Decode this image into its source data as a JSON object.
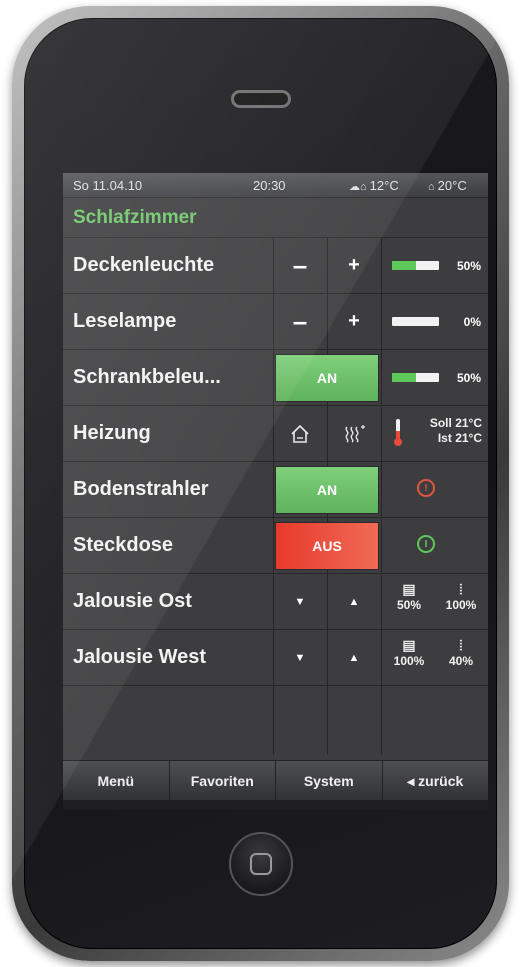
{
  "status_bar": {
    "date": "So 11.04.10",
    "time": "20:30",
    "outdoor_icon": "outdoor-temp-icon",
    "outdoor_temp": "12°C",
    "indoor_icon": "house-temp-icon",
    "indoor_temp": "20°C"
  },
  "room": {
    "title": "Schlafzimmer"
  },
  "devices": [
    {
      "label": "Deckenleuchte",
      "type": "dimmer",
      "minus": "–",
      "plus": "+",
      "level": 0.5,
      "value": "50%"
    },
    {
      "label": "Leselampe",
      "type": "dimmer",
      "minus": "–",
      "plus": "+",
      "level": 0.0,
      "value": "0%"
    },
    {
      "label": "Schrankbeleu...",
      "type": "switch-dimmer",
      "state": "AN",
      "level": 0.5,
      "value": "50%"
    },
    {
      "label": "Heizung",
      "type": "heating",
      "mode_icon": "house-mode-icon",
      "heat_icon": "heat-boost-icon",
      "set_label": "Soll",
      "set_temp": "21°C",
      "actual_label": "Ist",
      "actual_temp": "21°C"
    },
    {
      "label": "Bodenstrahler",
      "type": "switch",
      "state": "AN",
      "status_symbol": "!"
    },
    {
      "label": "Steckdose",
      "type": "switch",
      "state": "AUS",
      "status_symbol": "I"
    },
    {
      "label": "Jalousie Ost",
      "type": "blind",
      "down": "▼",
      "up": "▲",
      "position": "50%",
      "slat": "100%"
    },
    {
      "label": "Jalousie West",
      "type": "blind",
      "down": "▼",
      "up": "▲",
      "position": "100%",
      "slat": "40%"
    }
  ],
  "tabs": [
    "Menü",
    "Favoriten",
    "System",
    "◂ zurück"
  ],
  "colors": {
    "accent_green": "#6fc86a",
    "on_green": "#6fc26b",
    "off_red": "#ea4a36",
    "alert_red": "#e0553f"
  }
}
